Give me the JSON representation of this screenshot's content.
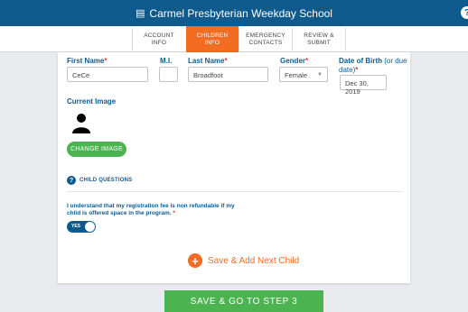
{
  "header": {
    "title": "Carmel Presbyterian Weekday School",
    "logo_icon": "school-icon",
    "help_icon": "help-icon"
  },
  "tabs": [
    {
      "line1": "ACCOUNT",
      "line2": "INFO",
      "active": false
    },
    {
      "line1": "CHILDREN",
      "line2": "INFO",
      "active": true
    },
    {
      "line1": "EMERGENCY",
      "line2": "CONTACTS",
      "active": false
    },
    {
      "line1": "REVIEW &",
      "line2": "SUBMIT",
      "active": false
    }
  ],
  "form": {
    "first_name": {
      "label": "First Name",
      "value": "CeCe"
    },
    "middle_initial": {
      "label": "M.I.",
      "value": ""
    },
    "last_name": {
      "label": "Last Name",
      "value": "Broadfoot"
    },
    "gender": {
      "label": "Gender",
      "value": "Female"
    },
    "dob": {
      "label": "Date of Birth",
      "label_suffix": "(or due date)",
      "value": "Dec 30, 2019"
    },
    "required_mark": "*"
  },
  "image": {
    "label": "Current Image",
    "change_button": "CHANGE IMAGE"
  },
  "questions": {
    "header": "CHILD QUESTIONS",
    "items": [
      {
        "text": "I understand that my registration fee is non refundable if my child is offered space in the program.",
        "toggle_label": "YES",
        "on": true
      }
    ]
  },
  "add_next_label": "Save & Add Next Child",
  "save_button": "SAVE & GO TO STEP 3",
  "colors": {
    "primary": "#0f5a8c",
    "accent": "#f26c22",
    "success": "#4bb350",
    "required": "#e13a2b"
  }
}
